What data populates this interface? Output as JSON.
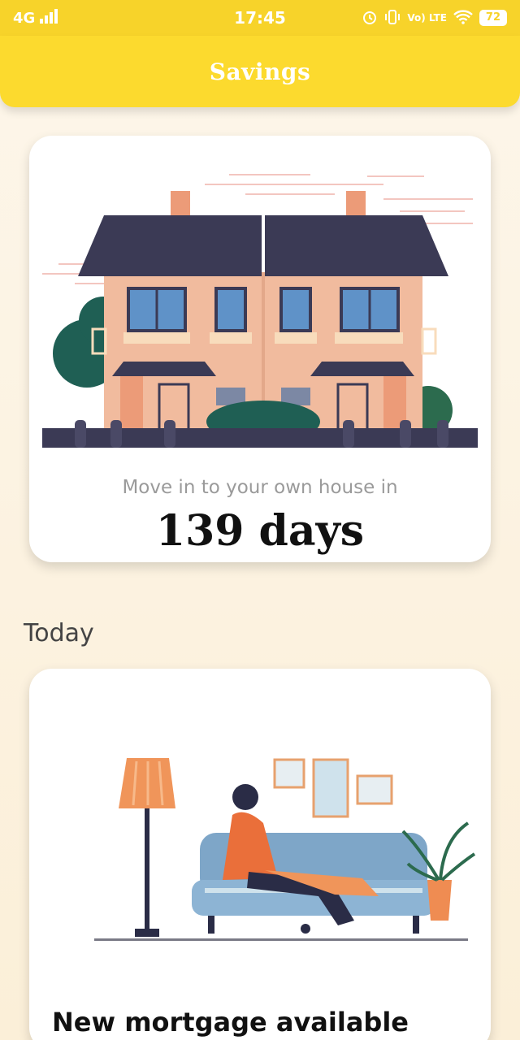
{
  "status_bar": {
    "network": "4G",
    "time": "17:45",
    "lte_label": "Vo) LTE",
    "battery": "72"
  },
  "app_bar": {
    "title": "Savings"
  },
  "house_card": {
    "caption": "Move in to your own house in",
    "days": "139 days"
  },
  "section": {
    "title": "Today"
  },
  "mortgage_card": {
    "title": "New mortgage available"
  },
  "colors": {
    "accent": "#fcda2e",
    "status": "#f7d32a",
    "roof": "#3b3a55",
    "wall": "#f1bb9e"
  }
}
